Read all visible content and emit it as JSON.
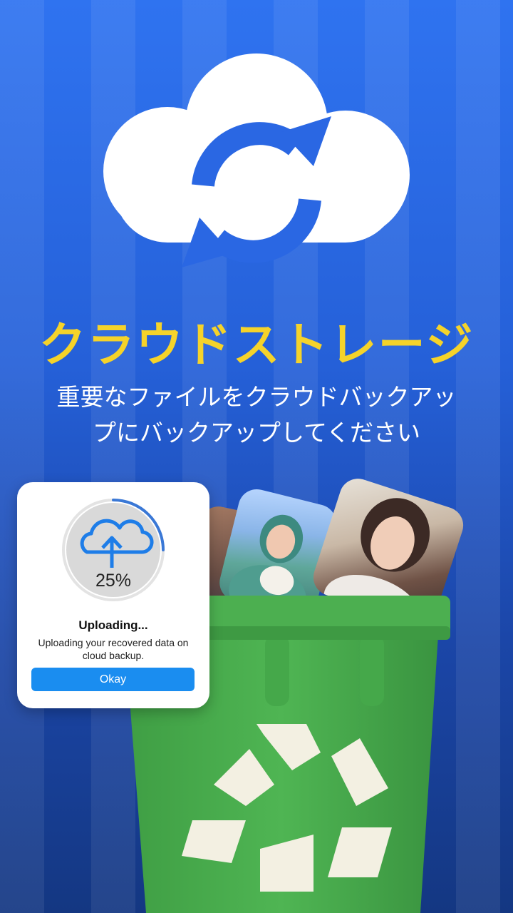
{
  "hero": {
    "icon": "cloud-sync-icon",
    "title": "クラウドストレージ",
    "subtitle_line1": "重要なファイルをクラウドバックアッ",
    "subtitle_line2": "プにバックアップしてください"
  },
  "dialog": {
    "icon": "cloud-upload-icon",
    "progress": 0.25,
    "progress_label": "25%",
    "title": "Uploading...",
    "message": "Uploading your recovered data on cloud backup.",
    "button_label": "Okay"
  },
  "illustration": {
    "bin_icon": "recycle-icon",
    "photos": [
      "photo-back",
      "photo-middle",
      "photo-front"
    ]
  },
  "colors": {
    "background": "#2563d9",
    "title": "#f5d32a",
    "accent_blue": "#1a8df0",
    "bin_green": "#4caf50",
    "recycle_symbol": "#f3f0e2"
  }
}
